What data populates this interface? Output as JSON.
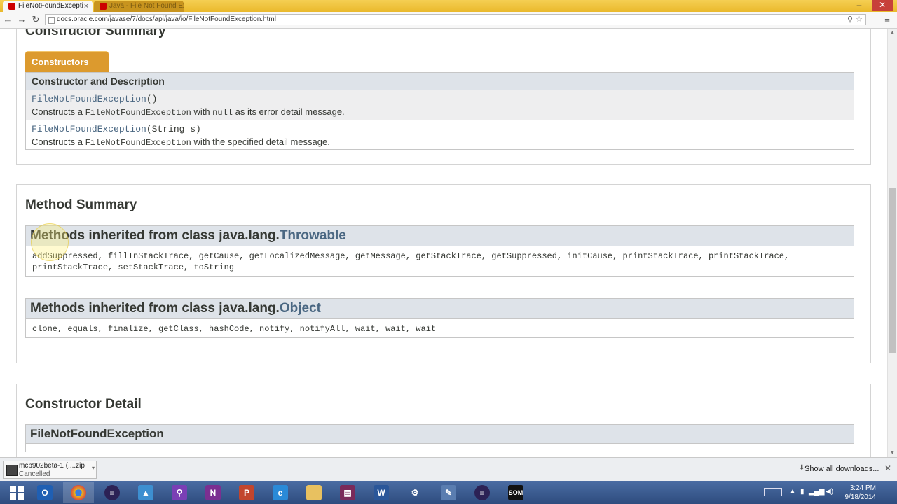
{
  "browser": {
    "tabs": [
      {
        "title": "FileNotFoundExcepti",
        "active": true
      },
      {
        "title": "Java - File Not Found Exception",
        "active": false
      }
    ],
    "address": "docs.oracle.com/javase/7/docs/api/java/io/FileNotFoundException.html"
  },
  "constructor_summary": {
    "title": "Constructor Summary",
    "caption": "Constructors",
    "header": "Constructor and Description",
    "rows": [
      {
        "name": "FileNotFoundException",
        "params": "()",
        "desc_before": "Constructs a ",
        "desc_code": "FileNotFoundException",
        "desc_mid": " with ",
        "desc_code2": "null",
        "desc_after": " as its error detail message."
      },
      {
        "name": "FileNotFoundException",
        "params": "(String s)",
        "desc_before": "Constructs a ",
        "desc_code": "FileNotFoundException",
        "desc_after": " with the specified detail message."
      }
    ]
  },
  "method_summary": {
    "title": "Method Summary",
    "inherited": [
      {
        "prefix": "Methods inherited from class java.lang.",
        "class": "Throwable",
        "methods": "addSuppressed, fillInStackTrace, getCause, getLocalizedMessage, getMessage, getStackTrace, getSuppressed, initCause, printStackTrace, printStackTrace, printStackTrace, setStackTrace, toString"
      },
      {
        "prefix": "Methods inherited from class java.lang.",
        "class": "Object",
        "methods": "clone, equals, finalize, getClass, hashCode, notify, notifyAll, wait, wait, wait"
      }
    ]
  },
  "constructor_detail": {
    "title": "Constructor Detail",
    "header": "FileNotFoundException"
  },
  "downloads": {
    "item_name": "mcp902beta-1 (....zip",
    "item_status": "Cancelled",
    "show_all": "Show all downloads..."
  },
  "taskbar": {
    "apps": [
      "outlook",
      "chrome",
      "eclipse",
      "photos",
      "search",
      "onenote",
      "powerpoint",
      "internet-explorer",
      "file-explorer",
      "winrar",
      "word",
      "network-tool",
      "paint",
      "eclipse-2",
      "som"
    ],
    "time": "3:24 PM",
    "date": "9/18/2014"
  }
}
